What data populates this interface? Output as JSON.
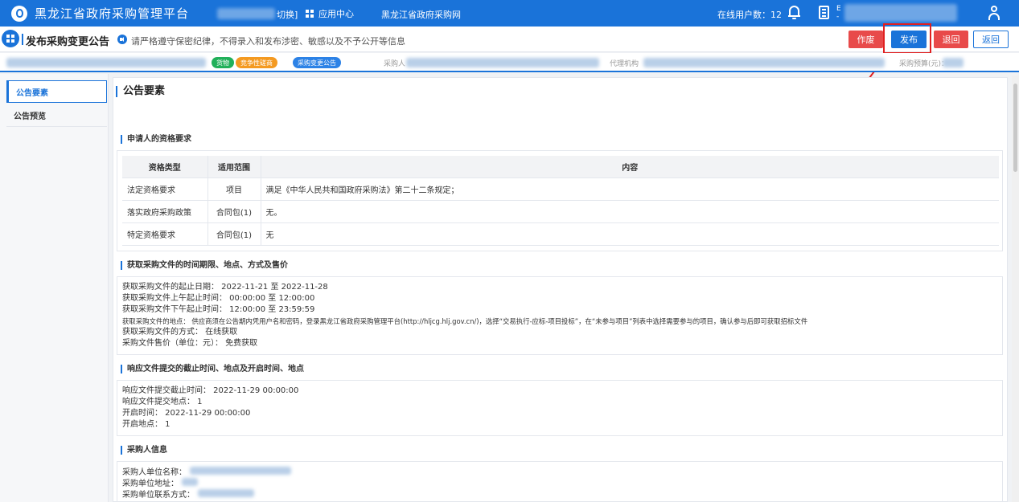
{
  "topbar": {
    "app_title": "黑龙江省政府采购管理平台",
    "user_suffix": "切换]",
    "app_center": "应用中心",
    "external_site": "黑龙江省政府采购网",
    "online_users_label": "在线用户数：12",
    "user_line1": "E",
    "user_line2": "-"
  },
  "header": {
    "page_title": "发布采购变更公告",
    "notice": "请严格遵守保密纪律，不得录入和发布涉密、敏感以及不予公开等信息",
    "buttons": {
      "void": "作废",
      "publish": "发布",
      "send_back": "退回",
      "return": "返回"
    },
    "colors": {
      "primary": "#1a73d9",
      "danger": "#e84a4a",
      "highlight": "#e02020"
    }
  },
  "infobar": {
    "tags": [
      "货物",
      "竞争性磋商",
      "采购变更公告"
    ],
    "purchaser_label": "采购人",
    "agency_label": "代理机构",
    "budget_label": "采购预算(元)："
  },
  "sidenav": {
    "items": [
      "公告要素",
      "公告预览"
    ]
  },
  "main": {
    "section_title": "公告要素",
    "qualification": {
      "title": "申请人的资格要求",
      "headers": [
        "资格类型",
        "适用范围",
        "内容"
      ],
      "rows": [
        [
          "法定资格要求",
          "项目",
          "满足《中华人民共和国政府采购法》第二十二条规定；"
        ],
        [
          "落实政府采购政策",
          "合同包(1)",
          "无。"
        ],
        [
          "特定资格要求",
          "合同包(1)",
          "无"
        ]
      ]
    },
    "acquisition": {
      "title": "获取采购文件的时间期限、地点、方式及售价",
      "lines": [
        "获取采购文件的起止日期：  2022-11-21 至 2022-11-28",
        "获取采购文件上午起止时间：  00:00:00 至 12:00:00",
        "获取采购文件下午起止时间：  12:00:00 至 23:59:59",
        "获取采购文件的地点：  供应商须在公告期内凭用户名和密码，登录黑龙江省政府采购管理平台(http://hljcg.hlj.gov.cn/)，选择“交易执行-应标-项目投标”，在“未参与项目”列表中选择需要参与的项目，确认参与后即可获取招标文件",
        "获取采购文件的方式：  在线获取",
        "采购文件售价（单位：元）：  免费获取"
      ]
    },
    "response": {
      "title": "响应文件提交的截止时间、地点及开启时间、地点",
      "lines": [
        "响应文件提交截止时间：  2022-11-29 00:00:00",
        "响应文件提交地点：  1",
        "开启时间：  2022-11-29 00:00:00",
        "开启地点：  1"
      ]
    },
    "purchaser": {
      "title": "采购人信息",
      "lines": [
        "采购人单位名称：",
        "采购单位地址：",
        "采购单位联系方式："
      ]
    }
  }
}
